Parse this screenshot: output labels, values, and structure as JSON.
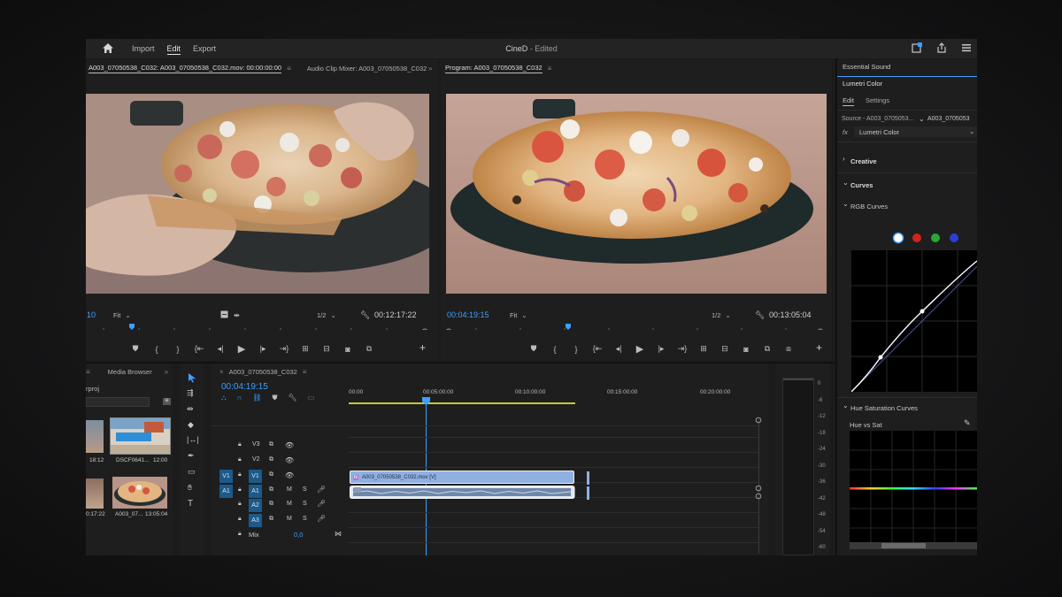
{
  "header": {
    "nav": [
      "Import",
      "Edit",
      "Export"
    ],
    "active": "Edit",
    "project_name": "CineD",
    "project_status": "- Edited"
  },
  "source_monitor": {
    "tab_source": "A003_07050538_C032: A003_07050538_C032.mov: 00:00:00:00",
    "tab_audio": "Audio Clip Mixer: A003_07050538_C032",
    "timecode_partial": "10",
    "fit": "Fit",
    "resolution": "1/2",
    "duration": "00:12:17:22"
  },
  "program_monitor": {
    "tab": "Program: A003_07050538_C032",
    "timecode": "00:04:19:15",
    "fit": "Fit",
    "resolution": "1/2",
    "duration": "00:13:05:04"
  },
  "project_panel": {
    "tab_media": "Media Browser",
    "project_file": "rproj",
    "items": [
      {
        "name": "",
        "duration": "18:12"
      },
      {
        "name": "DSCF0641...",
        "duration": "12:00"
      },
      {
        "name": "",
        "duration": "0:17:22"
      },
      {
        "name": "A003_07...",
        "duration": "13:05:04"
      }
    ]
  },
  "timeline": {
    "tab": "A003_07050538_C032",
    "timecode": "00:04:19:15",
    "ruler": [
      "00:00",
      "00:05:00:00",
      "00:10:00:00",
      "00:15:00:00",
      "00:20:00:00"
    ],
    "video_tracks": [
      "V3",
      "V2",
      "V1"
    ],
    "audio_tracks": [
      "A1",
      "A2",
      "A3"
    ],
    "source_v": "V1",
    "source_a": "A1",
    "clip_video_label": "A003_07050538_C032.mov [V]",
    "mix_label": "Mix",
    "mix_value": "0,0",
    "track_m": "M",
    "track_s": "S",
    "fx_badge": "fx"
  },
  "meter": {
    "scale": [
      "0",
      "-6",
      "-12",
      "-18",
      "-24",
      "-30",
      "-36",
      "-42",
      "-48",
      "-54",
      "-60"
    ]
  },
  "lumetri": {
    "essential_sound": "Essential Sound",
    "title": "Lumetri Color",
    "tab_edit": "Edit",
    "tab_settings": "Settings",
    "source_label": "Source - A003_0705053...",
    "source_clip": "A003_0705053",
    "fx_label": "fx",
    "fx_effect": "Lumetri Color",
    "section_creative": "Creative",
    "section_curves": "Curves",
    "rgb_curves": "RGB Curves",
    "hue_sat_curves": "Hue Saturation Curves",
    "hue_vs_sat": "Hue vs Sat",
    "channel_colors": [
      "#ffffff",
      "#d0231f",
      "#27a833",
      "#2a3fd1"
    ]
  },
  "colors": {
    "accent": "#3d9fff",
    "clip_video": "#8fb0e0",
    "clip_audio": "#dfe6f0",
    "track_on": "#1b5a8a",
    "work_area": "#c8c832"
  }
}
